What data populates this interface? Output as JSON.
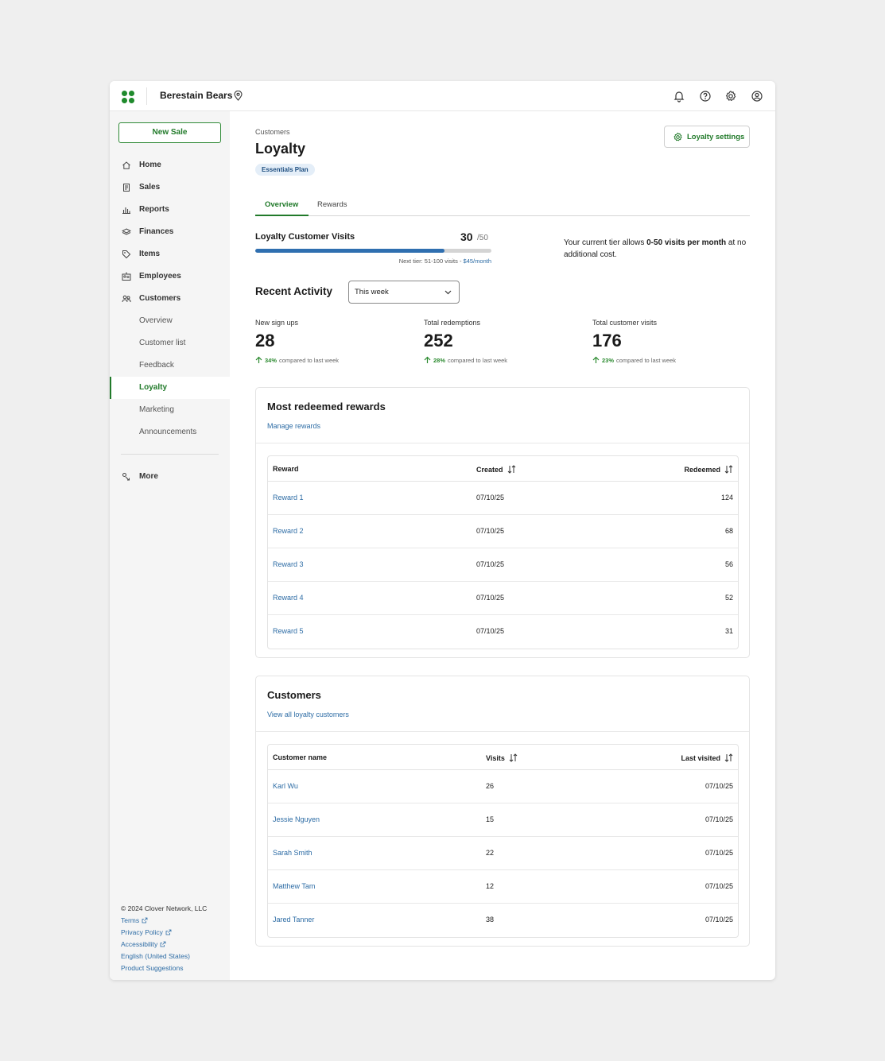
{
  "header": {
    "merchant_name": "Berestain Bears",
    "icons": [
      "bell-icon",
      "help-icon",
      "gear-icon",
      "account-icon"
    ]
  },
  "sidebar": {
    "new_sale_label": "New Sale",
    "items": [
      {
        "label": "Home",
        "icon": "home-icon"
      },
      {
        "label": "Sales",
        "icon": "receipt-icon"
      },
      {
        "label": "Reports",
        "icon": "bar-chart-icon"
      },
      {
        "label": "Finances",
        "icon": "layers-icon"
      },
      {
        "label": "Items",
        "icon": "tag-icon"
      },
      {
        "label": "Employees",
        "icon": "id-card-icon"
      },
      {
        "label": "Customers",
        "icon": "people-icon"
      }
    ],
    "customers_sub": [
      {
        "label": "Overview"
      },
      {
        "label": "Customer list"
      },
      {
        "label": "Feedback"
      },
      {
        "label": "Loyalty",
        "active": true
      },
      {
        "label": "Marketing"
      },
      {
        "label": "Announcements"
      }
    ],
    "more_label": "More",
    "footer": {
      "copyright": "© 2024 Clover Network, LLC",
      "links": [
        "Terms",
        "Privacy Policy",
        "Accessibility",
        "English (United States)",
        "Product Suggestions"
      ]
    }
  },
  "page": {
    "breadcrumb": "Customers",
    "title": "Loyalty",
    "plan_badge": "Essentials Plan",
    "settings_button": "Loyalty settings",
    "tabs": [
      {
        "label": "Overview",
        "active": true
      },
      {
        "label": "Rewards"
      }
    ]
  },
  "visits": {
    "label": "Loyalty Customer Visits",
    "value": "30",
    "limit": "/50",
    "progress_fraction": 0.8,
    "next_tier_text": "Next tier: 51-100 visits - ",
    "next_tier_price": "$45/month",
    "tier_prefix": "Your current tier allows ",
    "tier_bold": "0-50 visits per month",
    "tier_suffix": " at no additional cost."
  },
  "activity": {
    "title": "Recent Activity",
    "period": "This week",
    "compare_text": "compared to last week",
    "stats": [
      {
        "label": "New sign ups",
        "value": "28",
        "change": "34%"
      },
      {
        "label": "Total redemptions",
        "value": "252",
        "change": "28%"
      },
      {
        "label": "Total customer visits",
        "value": "176",
        "change": "23%"
      }
    ]
  },
  "rewards_card": {
    "title": "Most redeemed rewards",
    "link": "Manage rewards",
    "columns": [
      "Reward",
      "Created",
      "Redeemed"
    ],
    "rows": [
      {
        "name": "Reward 1",
        "created": "07/10/25",
        "redeemed": "124"
      },
      {
        "name": "Reward 2",
        "created": "07/10/25",
        "redeemed": "68"
      },
      {
        "name": "Reward 3",
        "created": "07/10/25",
        "redeemed": "56"
      },
      {
        "name": "Reward 4",
        "created": "07/10/25",
        "redeemed": "52"
      },
      {
        "name": "Reward 5",
        "created": "07/10/25",
        "redeemed": "31"
      }
    ]
  },
  "customers_card": {
    "title": "Customers",
    "link": "View all loyalty customers",
    "columns": [
      "Customer name",
      "Visits",
      "Last visited"
    ],
    "rows": [
      {
        "name": "Karl Wu",
        "visits": "26",
        "last": "07/10/25"
      },
      {
        "name": "Jessie Nguyen",
        "visits": "15",
        "last": "07/10/25"
      },
      {
        "name": "Sarah Smith",
        "visits": "22",
        "last": "07/10/25"
      },
      {
        "name": "Matthew Tam",
        "visits": "12",
        "last": "07/10/25"
      },
      {
        "name": "Jared Tanner",
        "visits": "38",
        "last": "07/10/25"
      }
    ]
  },
  "colors": {
    "brand_green": "#217a2a",
    "link_blue": "#2d6ca5",
    "progress_blue": "#2f6fb0"
  }
}
